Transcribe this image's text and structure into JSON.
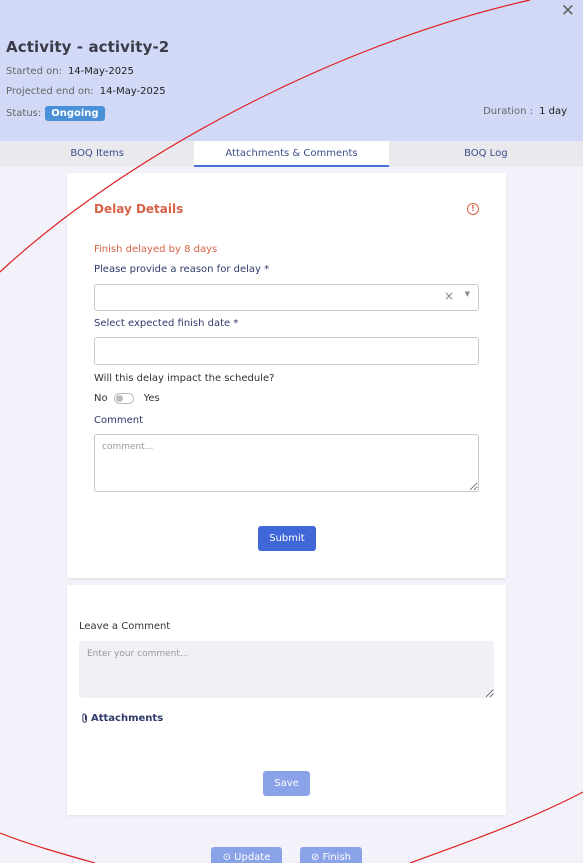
{
  "header": {
    "title": "Activity - activity-2",
    "started_label": "Started on:",
    "started_value": "14-May-2025",
    "projected_label": "Projected end on:",
    "projected_value": "14-May-2025",
    "status_label": "Status:",
    "status_value": "Ongoing",
    "duration_label": "Duration :",
    "duration_value": "1 day",
    "close_glyph": "✕"
  },
  "tabs": [
    {
      "label": "BOQ Items",
      "active": false
    },
    {
      "label": "Attachments & Comments",
      "active": true
    },
    {
      "label": "BOQ Log",
      "active": false
    }
  ],
  "delay": {
    "title": "Delay Details",
    "info_glyph": "!",
    "message": "Finish delayed by 8 days",
    "reason_label": "Please provide a reason for delay *",
    "reason_clear": "×",
    "reason_caret": "▼",
    "date_label": "Select expected finish date *",
    "impact_label": "Will this delay impact the schedule?",
    "toggle_no": "No",
    "toggle_yes": "Yes",
    "toggle_value": false,
    "comment_label": "Comment",
    "comment_placeholder": "comment...",
    "submit_label": "Submit"
  },
  "comments": {
    "leave_label": "Leave a Comment",
    "placeholder": "Enter your comment...",
    "attachments_label": "Attachments",
    "save_label": "Save"
  },
  "footer": {
    "update_label": "⊙ Update",
    "finish_label": "⊘ Finish"
  },
  "colors": {
    "header_bg": "#d2d9f7",
    "accent": "#3f67d8",
    "warning": "#d86246",
    "status": "#4a90d9",
    "overlay_line": "#e02020"
  }
}
